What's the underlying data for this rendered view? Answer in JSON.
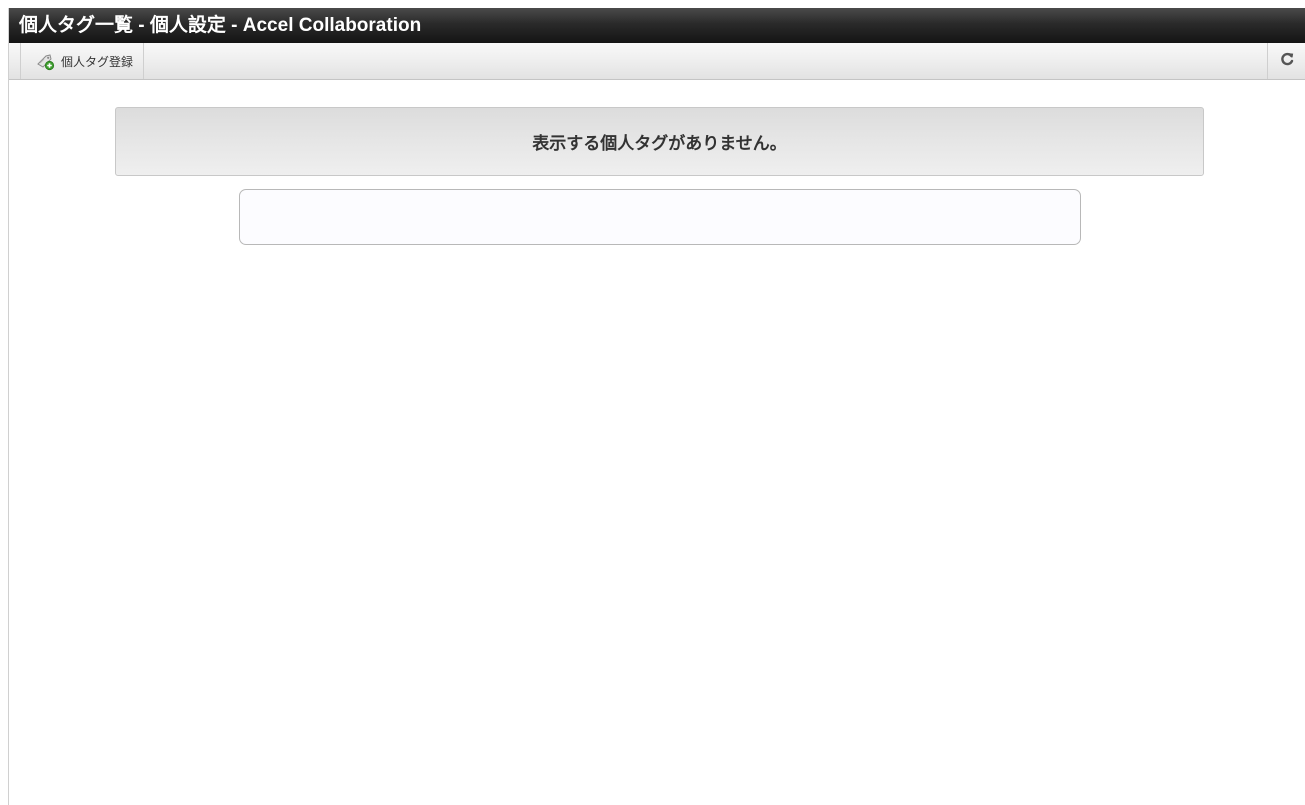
{
  "window": {
    "title": "個人タグ一覧 - 個人設定 - Accel Collaboration"
  },
  "toolbar": {
    "register_label": "個人タグ登録",
    "register_icon": "tag-add-icon",
    "refresh_icon": "refresh-icon"
  },
  "main": {
    "empty_message": "表示する個人タグがありません。"
  }
}
